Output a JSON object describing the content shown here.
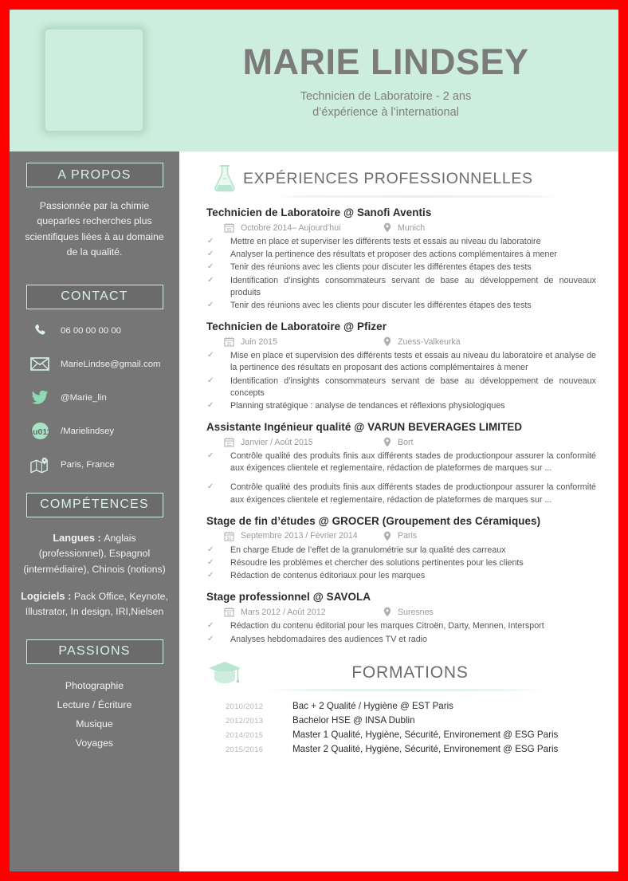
{
  "header": {
    "name": "MARIE LINDSEY",
    "tagline_line1": "Technicien de Laboratoire - 2 ans",
    "tagline_line2": "d’éxpérience à l’international",
    "photo_alt": "portrait-photo",
    "bg_color": "#cdeede",
    "name_color": "#7b7b7b"
  },
  "sidebar": {
    "bg_color": "#767676",
    "accent_color": "#cdeede",
    "about": {
      "heading": "A PROPOS",
      "text": "Passionnée par la chimie queparles recherches plus scientifiques liées à au domaine de la qualité."
    },
    "contact": {
      "heading": "CONTACT",
      "items": [
        {
          "icon": "phone-icon",
          "value": "06 00 00 00 00"
        },
        {
          "icon": "envelope-icon",
          "value": "MarieLindse@gmail.com"
        },
        {
          "icon": "twitter-icon",
          "value": "@Marie_lin"
        },
        {
          "icon": "behance-icon",
          "value": "/Marielindsey"
        },
        {
          "icon": "map-pin-icon",
          "value": "Paris, France"
        }
      ]
    },
    "competences": {
      "heading": "COMPÉTENCES",
      "langues_label": "Langues : ",
      "langues_value": "Anglais (professionnel), Espagnol (intermédiaire), Chinois (notions)",
      "logiciels_label": "Logiciels : ",
      "logiciels_value": "Pack Office, Keynote, Illustrator, In design, IRI,Nielsen"
    },
    "passions": {
      "heading": "PASSIONS",
      "items": [
        "Photographie",
        "Lecture / Écriture",
        "Musique",
        "Voyages"
      ]
    }
  },
  "main": {
    "experience": {
      "icon": "flask-icon",
      "title": "EXPÉRIENCES PROFESSIONNELLES",
      "jobs": [
        {
          "title": "Technicien de Laboratoire @ Sanofi Aventis",
          "date": "Octobre 2014– Aujourd’hui",
          "location": "Munich",
          "bullets": [
            "Mettre en place et superviser les différents tests et essais au niveau du laboratoire",
            "Analyser la pertinence des résultats et proposer des actions complémentaires à mener",
            "Tenir des réunions avec les clients pour discuter les différentes étapes des tests",
            "Identification d’insights consommateurs servant de base au développement de nouveaux produits",
            "Tenir des réunions avec les clients pour discuter les différentes étapes des tests"
          ]
        },
        {
          "title": "Technicien de Laboratoire @ Pfizer",
          "date": "Juin  2015",
          "location": "Zuess-Valkeurka",
          "bullets": [
            "Mise en place et supervision des différents tests et essais au niveau du laboratoire et analyse de la pertinence des résultats en proposant des actions complémentaires à mener",
            "Identification d’insights consommateurs servant de base au   développement de nouveaux concepts",
            "Planning stratégique : analyse de tendances et réflexions  physiologiques"
          ]
        },
        {
          "title": "Assistante Ingénieur qualité @ VARUN BEVERAGES LIMITED",
          "date": "Janvier / Août 2015",
          "location": "Bort",
          "bullets": [
            "Contrôle qualité des produits finis aux différents stades de productionpour assurer la conformité aux éxigences clientele et reglementaire, rédaction de plateformes de marques sur ...",
            "Contrôle qualité des produits finis aux différents stades de productionpour assurer la conformité aux éxigences clientele et reglementaire, rédaction de plateformes de marques sur ..."
          ]
        },
        {
          "title": "Stage de fin d’études @ GROCER (Groupement des Céramiques)",
          "date": "Septembre 2013 / Février 2014",
          "location": "Paris",
          "bullets": [
            "En charge Etude de l’effet de la granulométrie sur la qualité des carreaux",
            "Résoudre les problèmes et chercher des solutions pertinentes pour les clients",
            "Rédaction de contenus éditoriaux pour les  marques"
          ]
        },
        {
          "title": "Stage professionnel @ SAVOLA",
          "date": "Mars 2012 / Août 2012",
          "location": "Suresnes",
          "bullets": [
            "Rédaction du contenu éditorial pour les marques Citroën, Darty, Mennen,  Intersport",
            "Analyses hebdomadaires des audiences TV et  radio"
          ]
        }
      ]
    },
    "formations": {
      "icon": "graduation-cap-icon",
      "title": "FORMATIONS",
      "rows": [
        {
          "year": "2010/2012",
          "label": "Bac + 2 Qualité / Hygiène @ EST Paris"
        },
        {
          "year": "2012/2013",
          "label": "Bachelor HSE @ INSA Dublin"
        },
        {
          "year": "2014/2015",
          "label": "Master 1 Qualité, Hygiène, Sécurité, Environement @ ESG Paris"
        },
        {
          "year": "2015/2016",
          "label": "Master 2 Qualité, Hygiène, Sécurité, Environement @ ESG Paris"
        }
      ]
    }
  }
}
